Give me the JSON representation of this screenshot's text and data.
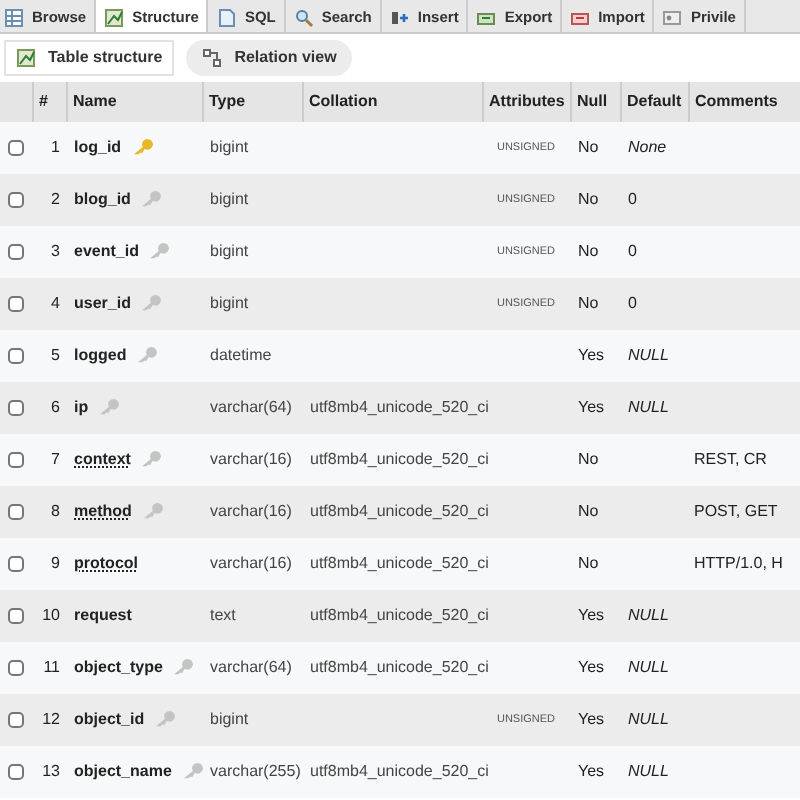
{
  "tabs": [
    {
      "label": "Browse",
      "selected": false
    },
    {
      "label": "Structure",
      "selected": true
    },
    {
      "label": "SQL",
      "selected": false
    },
    {
      "label": "Search",
      "selected": false
    },
    {
      "label": "Insert",
      "selected": false
    },
    {
      "label": "Export",
      "selected": false
    },
    {
      "label": "Import",
      "selected": false
    },
    {
      "label": "Privile",
      "selected": false
    }
  ],
  "subtabs": [
    {
      "label": "Table structure",
      "selected": true
    },
    {
      "label": "Relation view",
      "selected": false
    }
  ],
  "table": {
    "columns": [
      "#",
      "Name",
      "Type",
      "Collation",
      "Attributes",
      "Null",
      "Default",
      "Comments"
    ],
    "rows": [
      {
        "checked": false,
        "number": "1",
        "name": "log_id",
        "kind": "primary",
        "commented": false,
        "type": "bigint",
        "attributes": "UNSIGNED",
        "null": "No",
        "default": "None",
        "default_italic": true
      },
      {
        "checked": false,
        "number": "2",
        "name": "blog_id",
        "kind": "index",
        "commented": false,
        "type": "bigint",
        "attributes": "UNSIGNED",
        "null": "No",
        "default": "0",
        "default_italic": false
      },
      {
        "checked": false,
        "number": "3",
        "name": "event_id",
        "kind": "index",
        "commented": false,
        "type": "bigint",
        "attributes": "UNSIGNED",
        "null": "No",
        "default": "0",
        "default_italic": false
      },
      {
        "checked": false,
        "number": "4",
        "name": "user_id",
        "kind": "index",
        "commented": false,
        "type": "bigint",
        "attributes": "UNSIGNED",
        "null": "No",
        "default": "0",
        "default_italic": false
      },
      {
        "checked": false,
        "number": "5",
        "name": "logged",
        "kind": "index",
        "commented": false,
        "type": "datetime",
        "null": "Yes",
        "default": "NULL",
        "default_italic": true
      },
      {
        "checked": false,
        "number": "6",
        "name": "ip",
        "kind": "index",
        "commented": false,
        "type": "varchar(64)",
        "collation": "utf8mb4_unicode_520_ci",
        "null": "Yes",
        "default": "NULL",
        "default_italic": true
      },
      {
        "checked": false,
        "number": "7",
        "name": "context",
        "kind": "index",
        "commented": true,
        "type": "varchar(16)",
        "collation": "utf8mb4_unicode_520_ci",
        "null": "No",
        "comments": "REST, CR"
      },
      {
        "checked": false,
        "number": "8",
        "name": "method",
        "kind": "index",
        "commented": true,
        "type": "varchar(16)",
        "collation": "utf8mb4_unicode_520_ci",
        "null": "No",
        "comments": "POST, GET"
      },
      {
        "checked": false,
        "number": "9",
        "name": "protocol",
        "kind": "plain",
        "commented": true,
        "type": "varchar(16)",
        "collation": "utf8mb4_unicode_520_ci",
        "null": "No",
        "comments": "HTTP/1.0, H"
      },
      {
        "checked": false,
        "number": "10",
        "name": "request",
        "kind": "plain",
        "commented": false,
        "type": "text",
        "collation": "utf8mb4_unicode_520_ci",
        "null": "Yes",
        "default": "NULL",
        "default_italic": true
      },
      {
        "checked": false,
        "number": "11",
        "name": "object_type",
        "kind": "index",
        "commented": false,
        "type": "varchar(64)",
        "collation": "utf8mb4_unicode_520_ci",
        "null": "Yes",
        "default": "NULL",
        "default_italic": true
      },
      {
        "checked": false,
        "number": "12",
        "name": "object_id",
        "kind": "index",
        "commented": false,
        "type": "bigint",
        "attributes": "UNSIGNED",
        "null": "Yes",
        "default": "NULL",
        "default_italic": true
      },
      {
        "checked": false,
        "number": "13",
        "name": "object_name",
        "kind": "index",
        "commented": false,
        "type": "varchar(255)",
        "collation": "utf8mb4_unicode_520_ci",
        "null": "Yes",
        "default": "NULL",
        "default_italic": true
      }
    ]
  }
}
